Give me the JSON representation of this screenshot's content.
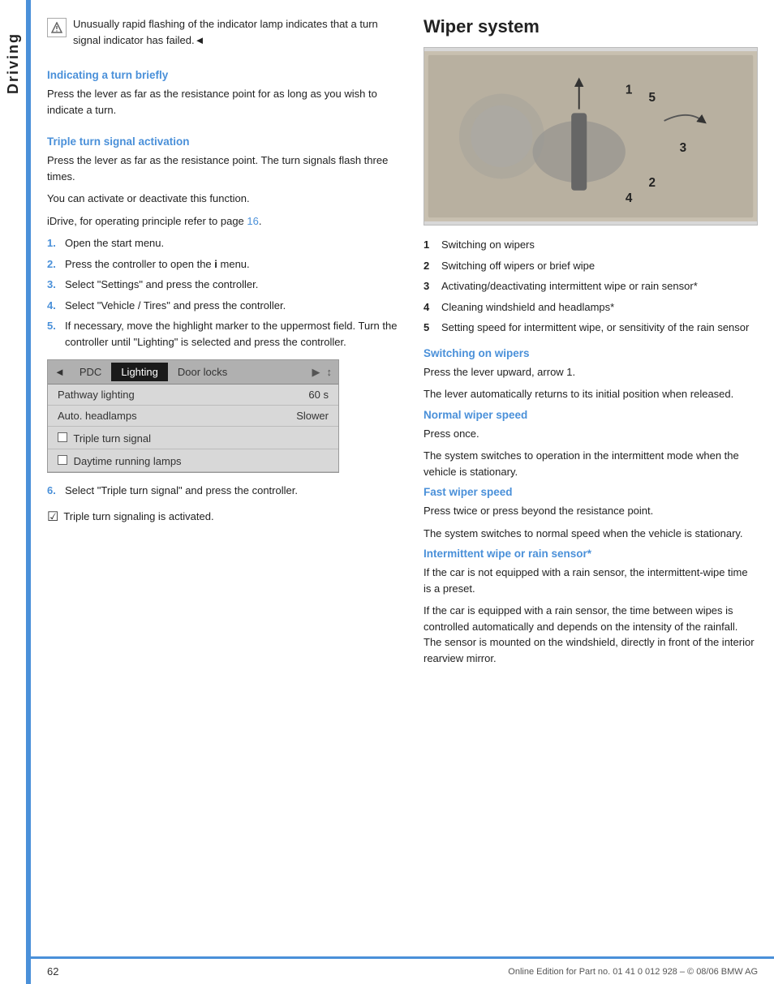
{
  "sidebar": {
    "label": "Driving"
  },
  "left_col": {
    "note": {
      "text": "Unusually rapid flashing of the indicator lamp indicates that a turn signal indicator has failed.◄"
    },
    "section1": {
      "heading": "Indicating a turn briefly",
      "para": "Press the lever as far as the resistance point for as long as you wish to indicate a turn."
    },
    "section2": {
      "heading": "Triple turn signal activation",
      "para1": "Press the lever as far as the resistance point. The turn signals flash three times.",
      "para2": "You can activate or deactivate this function.",
      "idrive_ref": "iDrive, for operating principle refer to page 16.",
      "steps": [
        {
          "num": "1.",
          "text": "Open the start menu."
        },
        {
          "num": "2.",
          "text": "Press the controller to open the Ⓘ menu."
        },
        {
          "num": "3.",
          "text": "Select \"Settings\" and press the controller."
        },
        {
          "num": "4.",
          "text": "Select \"Vehicle / Tires\" and press the controller."
        },
        {
          "num": "5.",
          "text": "If necessary, move the highlight marker to the uppermost field. Turn the controller until \"Lighting\" is selected and press the controller."
        }
      ],
      "menu": {
        "back": "◄",
        "tabs": [
          "PDC",
          "Lighting",
          "Door locks"
        ],
        "active_tab": "Lighting",
        "nav_icons": [
          "▶",
          "↕"
        ],
        "rows": [
          {
            "label": "Pathway lighting",
            "value": "60 s",
            "type": "normal"
          },
          {
            "label": "Auto. headlamps",
            "value": "Slower",
            "type": "normal"
          },
          {
            "label": "Triple turn signal",
            "value": "",
            "type": "checkbox"
          },
          {
            "label": "Daytime running lamps",
            "value": "",
            "type": "checkbox"
          }
        ]
      },
      "step6": {
        "num": "6.",
        "text": "Select \"Triple turn signal\" and press the controller."
      },
      "result": "Triple turn signaling is activated."
    }
  },
  "right_col": {
    "heading": "Wiper system",
    "diagram_alt": "Wiper control lever diagram with numbered positions",
    "wiper_items": [
      {
        "num": "1",
        "text": "Switching on wipers"
      },
      {
        "num": "2",
        "text": "Switching off wipers or brief wipe"
      },
      {
        "num": "3",
        "text": "Activating/deactivating intermittent wipe or rain sensor*"
      },
      {
        "num": "4",
        "text": "Cleaning windshield and headlamps*"
      },
      {
        "num": "5",
        "text": "Setting speed for intermittent wipe, or sensitivity of the rain sensor"
      }
    ],
    "section_switching": {
      "heading": "Switching on wipers",
      "para1": "Press the lever upward, arrow 1.",
      "para2": "The lever automatically returns to its initial position when released."
    },
    "section_normal": {
      "heading": "Normal wiper speed",
      "para1": "Press once.",
      "para2": "The system switches to operation in the intermittent mode when the vehicle is stationary."
    },
    "section_fast": {
      "heading": "Fast wiper speed",
      "para1": "Press twice or press beyond the resistance point.",
      "para2": "The system switches to normal speed when the vehicle is stationary."
    },
    "section_intermittent": {
      "heading": "Intermittent wipe or rain sensor*",
      "para1": "If the car is not equipped with a rain sensor, the intermittent-wipe time is a preset.",
      "para2": "If the car is equipped with a rain sensor, the time between wipes is controlled automatically and depends on the intensity of the rainfall. The sensor is mounted on the windshield, directly in front of the interior rearview mirror."
    }
  },
  "footer": {
    "page_num": "62",
    "copyright": "Online Edition for Part no. 01 41 0 012 928 – © 08/06 BMW AG"
  }
}
